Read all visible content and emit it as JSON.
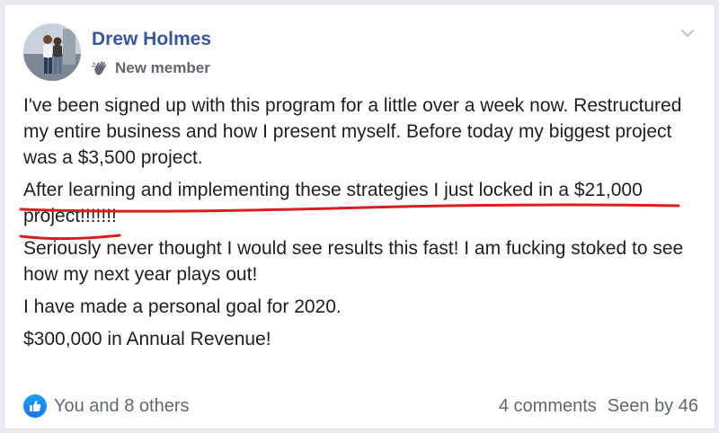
{
  "post": {
    "author": "Drew Holmes",
    "badge": "New member",
    "paragraphs": [
      "I've been signed up with this program for a little over a week now. Restructured my entire business and how I present myself. Before today my biggest project was a $3,500 project.",
      "After learning and implementing these strategies I just locked in a $21,000 project!!!!!!!",
      "Seriously never thought I would see results this fast! I am fucking stoked to see how my next year plays out!",
      "I have made a personal goal for 2020.",
      "$300,000 in Annual Revenue!"
    ]
  },
  "footer": {
    "reactions": "You and 8 others",
    "comments": "4 comments",
    "seen": "Seen by 46"
  },
  "colors": {
    "name": "#385898",
    "like": "#1877f2",
    "underline": "#d81e1e"
  },
  "icons": {
    "badge": "waving-hand-icon",
    "menu": "chevron-down-icon",
    "reaction": "thumbs-up-icon"
  }
}
